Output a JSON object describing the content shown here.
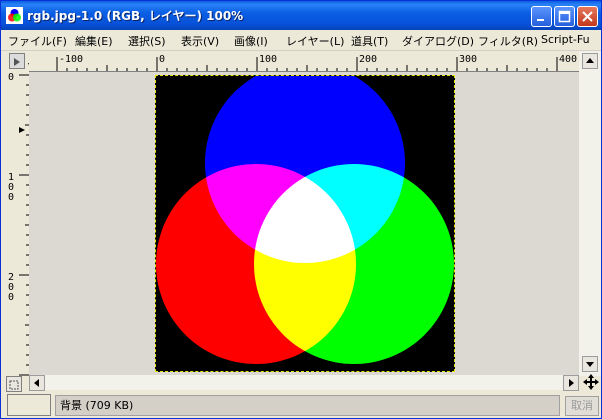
{
  "window": {
    "title": "rgb.jpg-1.0 (RGB, レイヤー) 100%",
    "buttons": [
      "minimize-icon",
      "maximize-icon",
      "close-icon"
    ]
  },
  "menu": {
    "items": [
      "ファイル(F)",
      "編集(E)",
      "選択(S)",
      "表示(V)",
      "画像(I)",
      "レイヤー(L)",
      "道具(T)",
      "ダイアログ(D)",
      "フィルタ(R)",
      "Script-Fu"
    ]
  },
  "ruler": {
    "horizontal_labels": [
      "-100",
      "0",
      "100",
      "200",
      "300",
      "400"
    ],
    "vertical_labels": [
      "0",
      "100",
      "200"
    ]
  },
  "image": {
    "background": "#000000",
    "circles": [
      {
        "name": "blue-circle",
        "color": "#0000ff"
      },
      {
        "name": "red-circle",
        "color": "#ff0000"
      },
      {
        "name": "green-circle",
        "color": "#00ff00"
      }
    ]
  },
  "status": {
    "text": "背景 (709 KB)",
    "cancel_label": "取消"
  }
}
